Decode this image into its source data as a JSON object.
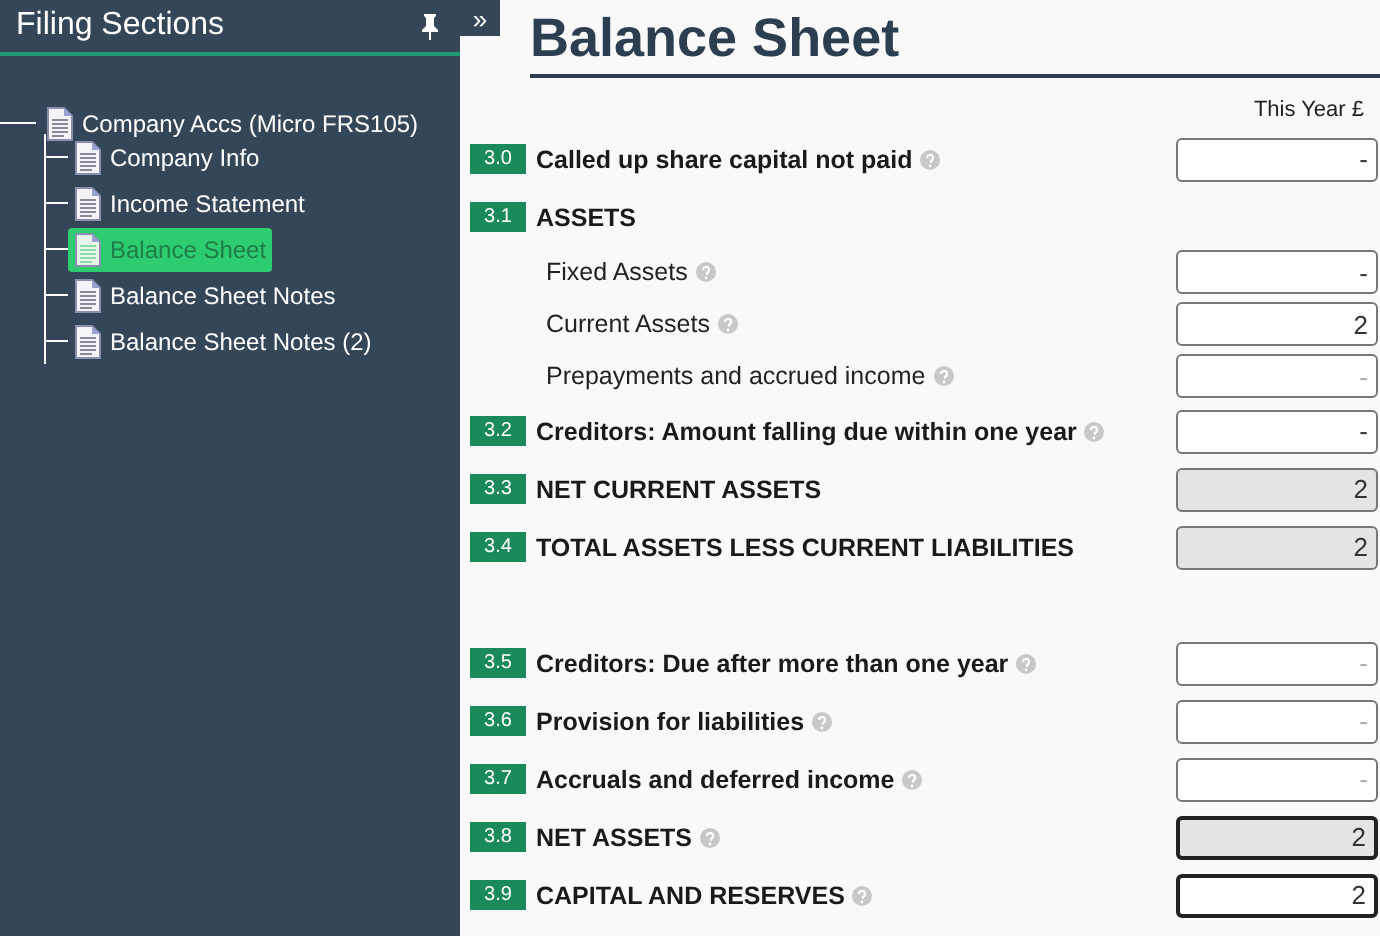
{
  "sidebar": {
    "title": "Filing Sections",
    "tree": [
      {
        "label": "Company Accs (Micro FRS105)",
        "selected": false,
        "children": [
          {
            "label": "Company Info",
            "selected": false
          },
          {
            "label": "Income Statement",
            "selected": false
          },
          {
            "label": "Balance Sheet",
            "selected": true
          },
          {
            "label": "Balance Sheet Notes",
            "selected": false
          },
          {
            "label": "Balance Sheet Notes (2)",
            "selected": false
          }
        ]
      }
    ]
  },
  "collapse_label": "»",
  "page": {
    "title": "Balance Sheet",
    "column_heading": "This Year £",
    "groups": [
      [
        {
          "kind": "section",
          "number": "3.0",
          "label": "Called up share capital not paid",
          "help": true,
          "field": {
            "value": "-",
            "readonly": false,
            "emphasized": false
          }
        },
        {
          "kind": "section",
          "number": "3.1",
          "label": "ASSETS",
          "help": false
        },
        {
          "kind": "sub",
          "label": "Fixed Assets",
          "help": true,
          "field": {
            "value": "-",
            "readonly": false,
            "emphasized": false
          }
        },
        {
          "kind": "sub",
          "label": "Current Assets",
          "help": true,
          "field": {
            "value": "2",
            "readonly": false,
            "emphasized": false
          }
        },
        {
          "kind": "sub",
          "label": "Prepayments and accrued income",
          "help": true,
          "field": {
            "placeholder": "-",
            "readonly": false,
            "emphasized": false
          }
        },
        {
          "kind": "section",
          "number": "3.2",
          "label": "Creditors: Amount falling due within one year",
          "help": true,
          "field": {
            "value": "-",
            "readonly": false,
            "emphasized": false
          }
        },
        {
          "kind": "section",
          "number": "3.3",
          "label": "NET CURRENT ASSETS",
          "help": false,
          "field": {
            "value": "2",
            "readonly": true,
            "emphasized": false
          }
        },
        {
          "kind": "section",
          "number": "3.4",
          "label": "TOTAL ASSETS LESS CURRENT LIABILITIES",
          "help": false,
          "field": {
            "value": "2",
            "readonly": true,
            "emphasized": false
          }
        }
      ],
      [
        {
          "kind": "section",
          "number": "3.5",
          "label": "Creditors: Due after more than one year",
          "help": true,
          "field": {
            "placeholder": "-",
            "readonly": false,
            "emphasized": false
          }
        },
        {
          "kind": "section",
          "number": "3.6",
          "label": "Provision for liabilities",
          "help": true,
          "field": {
            "placeholder": "-",
            "readonly": false,
            "emphasized": false
          }
        },
        {
          "kind": "section",
          "number": "3.7",
          "label": "Accruals and deferred income",
          "help": true,
          "field": {
            "placeholder": "-",
            "readonly": false,
            "emphasized": false
          }
        },
        {
          "kind": "section",
          "number": "3.8",
          "label": "NET ASSETS",
          "help": true,
          "field": {
            "value": "2",
            "readonly": true,
            "emphasized": true
          }
        },
        {
          "kind": "section",
          "number": "3.9",
          "label": "CAPITAL AND RESERVES",
          "help": true,
          "field": {
            "value": "2",
            "readonly": false,
            "emphasized": true
          }
        }
      ]
    ]
  }
}
